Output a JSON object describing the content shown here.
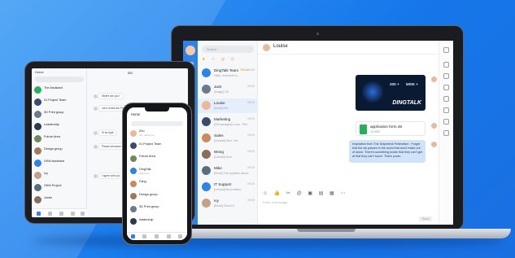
{
  "laptop": {
    "search_placeholder": "Search",
    "chat_title": "Louise",
    "contacts": [
      {
        "name": "DingTalk Team",
        "badge": "Official",
        "msg": "Hello, welcome to...",
        "time": "09:00",
        "color": "#2e82e8"
      },
      {
        "name": "Jack",
        "badge": "",
        "msg": "[Image] OK",
        "time": "09:00",
        "color": "#6a7b8c"
      },
      {
        "name": "Louise",
        "badge": "",
        "msg": "[Read] File",
        "time": "09:00",
        "color": "#e9b99b"
      },
      {
        "name": "Marketing",
        "badge": "",
        "msg": "[Oli managed] Louis : Pile",
        "time": "09:00",
        "color": "#3a4b6e"
      },
      {
        "name": "Sales",
        "badge": "",
        "msg": "[Unread] Wes: Yes",
        "time": "09:00",
        "color": "#c98b5e"
      },
      {
        "name": "Wong",
        "badge": "",
        "msg": "[Unread] Sure",
        "time": "09:00",
        "color": "#8a6d5a"
      },
      {
        "name": "Mike",
        "badge": "",
        "msg": "[Read] The question about",
        "time": "09:00",
        "color": "#5a6d7e"
      },
      {
        "name": "IT Support",
        "badge": "",
        "msg": "[Unread] No problem",
        "time": "09:00",
        "color": "#2e82e8"
      },
      {
        "name": "Ivy",
        "badge": "",
        "msg": "[Read] Check it",
        "time": "09:00",
        "color": "#c2a08a"
      }
    ],
    "banner_brand": "DINGTALK",
    "banner_stats": [
      "200 +",
      "500K +"
    ],
    "file_name": "application form.xls",
    "file_size": "18.6KB",
    "quote": "Inspiration from The Shipwreck Federation : Forget that the we passes in the world that won't make out of stone. There's something inside that they can't get at that they can't touch. That's yours.",
    "input_placeholder": "Enter a message",
    "send_label": "Send",
    "toolbar_icons": [
      "smile-icon",
      "thumbs-up-icon",
      "scissors-icon",
      "at-icon",
      "folder-icon",
      "image-icon",
      "calendar-icon",
      "more-icon"
    ]
  },
  "tablet": {
    "title": "Home",
    "chat_name": "Ian",
    "contacts": [
      {
        "name": "The Assistant",
        "msg": "",
        "color": "#27b05a"
      },
      {
        "name": "01 Project Team",
        "msg": "",
        "color": "#3a4b6e"
      },
      {
        "name": "3D Print group",
        "msg": "",
        "color": "#6a7b8c"
      },
      {
        "name": "Leadership",
        "msg": "",
        "color": "#2b3a4e"
      },
      {
        "name": "Future Area",
        "msg": "",
        "color": "#6d8b5a"
      },
      {
        "name": "Design group",
        "msg": "",
        "color": "#a0785e"
      },
      {
        "name": "OKM Assistant",
        "msg": "",
        "color": "#2e82e8"
      },
      {
        "name": "Ivy",
        "msg": "",
        "color": "#c2a08a"
      },
      {
        "name": "OKM Project",
        "msg": "",
        "color": "#5a6d7e"
      },
      {
        "name": "Justin",
        "msg": "",
        "color": "#8a6d5a"
      }
    ],
    "messages": [
      "Where are you?",
      "Let's review the Project lst",
      "I'll be right",
      "Please introduce the",
      "I agree with you"
    ]
  },
  "phone": {
    "title": "Home",
    "contacts": [
      {
        "name": "Zhu",
        "msg": "OK, thank you",
        "color": "#e9b99b"
      },
      {
        "name": "01 Project Team",
        "msg": "",
        "color": "#3a4b6e"
      },
      {
        "name": "Future Area",
        "msg": "",
        "color": "#6d8b5a"
      },
      {
        "name": "DingTalk",
        "msg": "Welcome",
        "color": "#2e82e8"
      },
      {
        "name": "Fang",
        "msg": "",
        "color": "#c98b5e"
      },
      {
        "name": "Design group",
        "msg": "",
        "color": "#a0785e"
      },
      {
        "name": "3D Print group",
        "msg": "",
        "color": "#6a7b8c"
      },
      {
        "name": "leadership",
        "msg": "",
        "color": "#2b3a4e"
      }
    ]
  }
}
